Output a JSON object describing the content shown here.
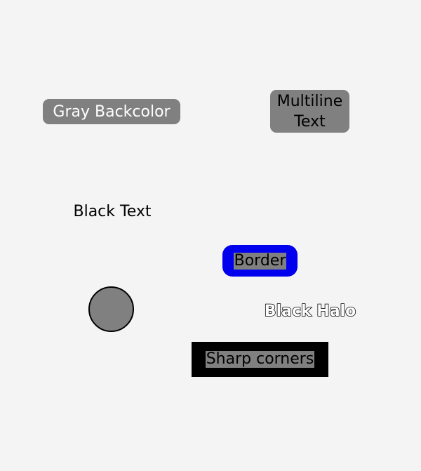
{
  "labels": {
    "gray_backcolor": "Gray Backcolor",
    "multiline_text": "Multiline\nText",
    "black_text": "Black Text",
    "border": "Border",
    "black_halo": "Black Halo",
    "sharp_corners": "Sharp corners"
  },
  "colors": {
    "background": "#f4f4f4",
    "label_fill": "#808080",
    "border_blue": "#0000ee",
    "black": "#000000",
    "white": "#ffffff"
  }
}
